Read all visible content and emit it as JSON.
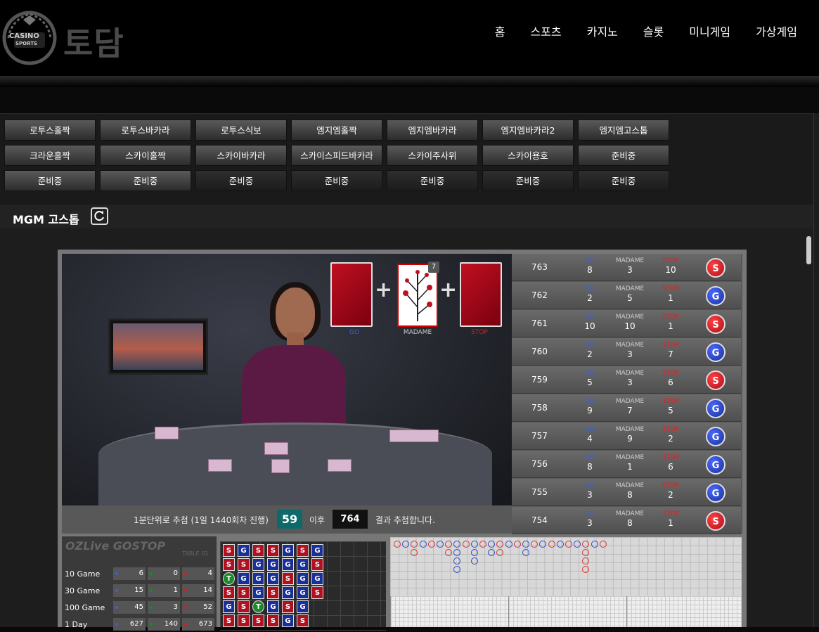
{
  "header": {
    "logo_text": [
      "CASINO",
      "SPORTS"
    ],
    "brand": "토담",
    "nav": [
      "홈",
      "스포츠",
      "카지노",
      "슬롯",
      "미니게임",
      "가상게임"
    ]
  },
  "games": [
    [
      "로투스홀짝",
      "로투스바카라",
      "로투스식보",
      "엠지엠홀짝",
      "엠지엠바카라",
      "엠지엠바카라2",
      "엠지엠고스톱"
    ],
    [
      "크라운홀짝",
      "스카이홀짝",
      "스카이바카라",
      "스카이스피드바카라",
      "스카이주사위",
      "스카이용호",
      "준비중"
    ],
    [
      "준비중",
      "준비중",
      "준비중",
      "준비중",
      "준비중",
      "준비중",
      "준비중"
    ]
  ],
  "section": {
    "title": "MGM 고스톱",
    "refresh_icon": "refresh-icon"
  },
  "video": {
    "card_labels": [
      "GO",
      "MADAME",
      "STOP"
    ],
    "card_badge": "7",
    "plus": "+"
  },
  "results": {
    "headers": {
      "go": "GO",
      "madame": "MADAME",
      "stop": "STOP"
    },
    "rows": [
      {
        "round": "763",
        "go": "8",
        "madame": "3",
        "stop": "10",
        "result": "S"
      },
      {
        "round": "762",
        "go": "2",
        "madame": "5",
        "stop": "1",
        "result": "G"
      },
      {
        "round": "761",
        "go": "10",
        "madame": "10",
        "stop": "1",
        "result": "S"
      },
      {
        "round": "760",
        "go": "2",
        "madame": "3",
        "stop": "7",
        "result": "G"
      },
      {
        "round": "759",
        "go": "5",
        "madame": "3",
        "stop": "6",
        "result": "S"
      },
      {
        "round": "758",
        "go": "9",
        "madame": "7",
        "stop": "5",
        "result": "G"
      },
      {
        "round": "757",
        "go": "4",
        "madame": "9",
        "stop": "2",
        "result": "G"
      },
      {
        "round": "756",
        "go": "8",
        "madame": "1",
        "stop": "6",
        "result": "G"
      },
      {
        "round": "755",
        "go": "3",
        "madame": "8",
        "stop": "2",
        "result": "G"
      },
      {
        "round": "754",
        "go": "3",
        "madame": "8",
        "stop": "1",
        "result": "S"
      }
    ]
  },
  "info_bar": {
    "text1": "1분단위로 추첨 (1일 1440회차 진행)",
    "countdown": "59",
    "text2": "이후",
    "next_round": "764",
    "text3": "결과 추첨합니다."
  },
  "stats": {
    "logo": "OZLive GOSTOP",
    "table": "TABLE 01",
    "rows": [
      {
        "label": "10 Game",
        "go": "6",
        "tie": "0",
        "stop": "4"
      },
      {
        "label": "30 Game",
        "go": "15",
        "tie": "1",
        "stop": "14"
      },
      {
        "label": "100 Game",
        "go": "45",
        "tie": "3",
        "stop": "52"
      },
      {
        "label": "1 Day",
        "go": "627",
        "tie": "140",
        "stop": "673"
      }
    ]
  },
  "bead_road": [
    [
      "S",
      "G",
      "S",
      "S",
      "G",
      "S",
      "G"
    ],
    [
      "S",
      "S",
      "G",
      "G",
      "G",
      "G",
      "S"
    ],
    [
      "T",
      "G",
      "G",
      "G",
      "S",
      "G",
      "G"
    ],
    [
      "S",
      "S",
      "G",
      "S",
      "G",
      "G",
      "S"
    ],
    [
      "G",
      "S",
      "T",
      "G",
      "S",
      "G"
    ],
    [
      "S",
      "S",
      "S",
      "S",
      "G",
      "S"
    ]
  ],
  "colors": {
    "go": "#1a2f9a",
    "stop": "#b01020",
    "tie": "#1a8a2a",
    "accent_box": "#0e6a6a"
  }
}
